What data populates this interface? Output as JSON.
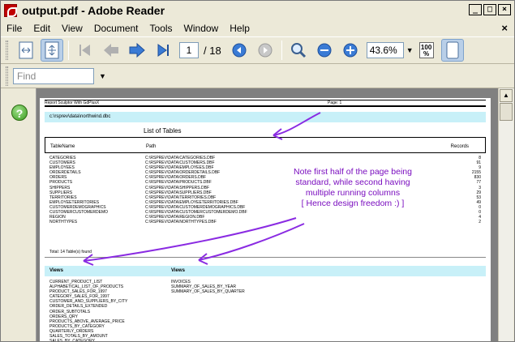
{
  "window": {
    "title": "output.pdf - Adobe Reader",
    "min": "_",
    "max": "□",
    "close": "×"
  },
  "menu": {
    "items": [
      "File",
      "Edit",
      "View",
      "Document",
      "Tools",
      "Window",
      "Help"
    ],
    "close": "×"
  },
  "toolbar": {
    "page_current": "1",
    "page_total": "/ 18",
    "zoom": "43.6%",
    "fit_width_top": "100",
    "fit_width_bottom": "%"
  },
  "find": {
    "placeholder": "Find"
  },
  "document": {
    "header_left": "Report Sculptor With GdPlusX",
    "header_right": "Page: 1",
    "db_path": "c:\\rsprev\\data\\northwind.dbc",
    "list_title": "List of Tables",
    "columns": [
      "TableName",
      "Path",
      "Records"
    ],
    "rows": [
      [
        "CATEGORIES",
        "C:\\RSPREV\\DATA\\CATEGORIES.DBF",
        "8"
      ],
      [
        "CUSTOMERS",
        "C:\\RSPREV\\DATA\\CUSTOMERS.DBF",
        "91"
      ],
      [
        "EMPLOYEES",
        "C:\\RSPREV\\DATA\\EMPLOYEES.DBF",
        "9"
      ],
      [
        "ORDERDETAILS",
        "C:\\RSPREV\\DATA\\ORDERDETAILS.DBF",
        "2155"
      ],
      [
        "ORDERS",
        "C:\\RSPREV\\DATA\\ORDERS.DBF",
        "830"
      ],
      [
        "PRODUCTS",
        "C:\\RSPREV\\DATA\\PRODUCTS.DBF",
        "77"
      ],
      [
        "SHIPPERS",
        "C:\\RSPREV\\DATA\\SHIPPERS.DBF",
        "3"
      ],
      [
        "SUPPLIERS",
        "C:\\RSPREV\\DATA\\SUPPLIERS.DBF",
        "29"
      ],
      [
        "TERRITORIES",
        "C:\\RSPREV\\DATA\\TERRITORIES.DBF",
        "53"
      ],
      [
        "EMPLOYEETERRITORIES",
        "C:\\RSPREV\\DATA\\EMPLOYEETERRITORIES.DBF",
        "49"
      ],
      [
        "CUSTOMERDEMOGRAPHICS",
        "C:\\RSPREV\\DATA\\CUSTOMERDEMOGRAPHICS.DBF",
        "0"
      ],
      [
        "CUSTOMERCUSTOMERDEMO",
        "C:\\RSPREV\\DATA\\CUSTOMERCUSTOMERDEMO.DBF",
        "0"
      ],
      [
        "REGION",
        "C:\\RSPREV\\DATA\\REGION.DBF",
        "4"
      ],
      [
        "NORTHTYPES",
        "C:\\RSPREV\\DATA\\NORTHTYPES.DBF",
        "2"
      ]
    ],
    "total": "Total:    14 Table(s) found",
    "views_label_1": "Views",
    "views_label_2": "Views",
    "views_col1": [
      "CURRENT_PRODUCT_LIST",
      "ALPHABETICAL_LIST_OF_PRODUCTS",
      "PRODUCT_SALES_FOR_1997",
      "CATEGORY_SALES_FOR_1997",
      "CUSTOMER_AND_SUPPLIERS_BY_CITY",
      "ORDER_DETAILS_EXTENDED",
      "ORDER_SUBTOTALS",
      "ORDERS_QRY",
      "PRODUCTS_ABOVE_AVERAGE_PRICE",
      "PRODUCTS_BY_CATEGORY",
      "QUARTERLY_ORDERS",
      "SALES_TOTALS_BY_AMOUNT",
      "SALES_BY_CATEGORY"
    ],
    "views_col2": [
      "INVOICES",
      "SUMMARY_OF_SALES_BY_YEAR",
      "SUMMARY_OF_SALES_BY_QUARTER"
    ]
  },
  "annotation": {
    "lines": [
      "Note first  half of the page being",
      "standard, while second having",
      "multiple running columns",
      "[  Hence design freedom :)  ]"
    ],
    "color": "#7a0dbf"
  }
}
